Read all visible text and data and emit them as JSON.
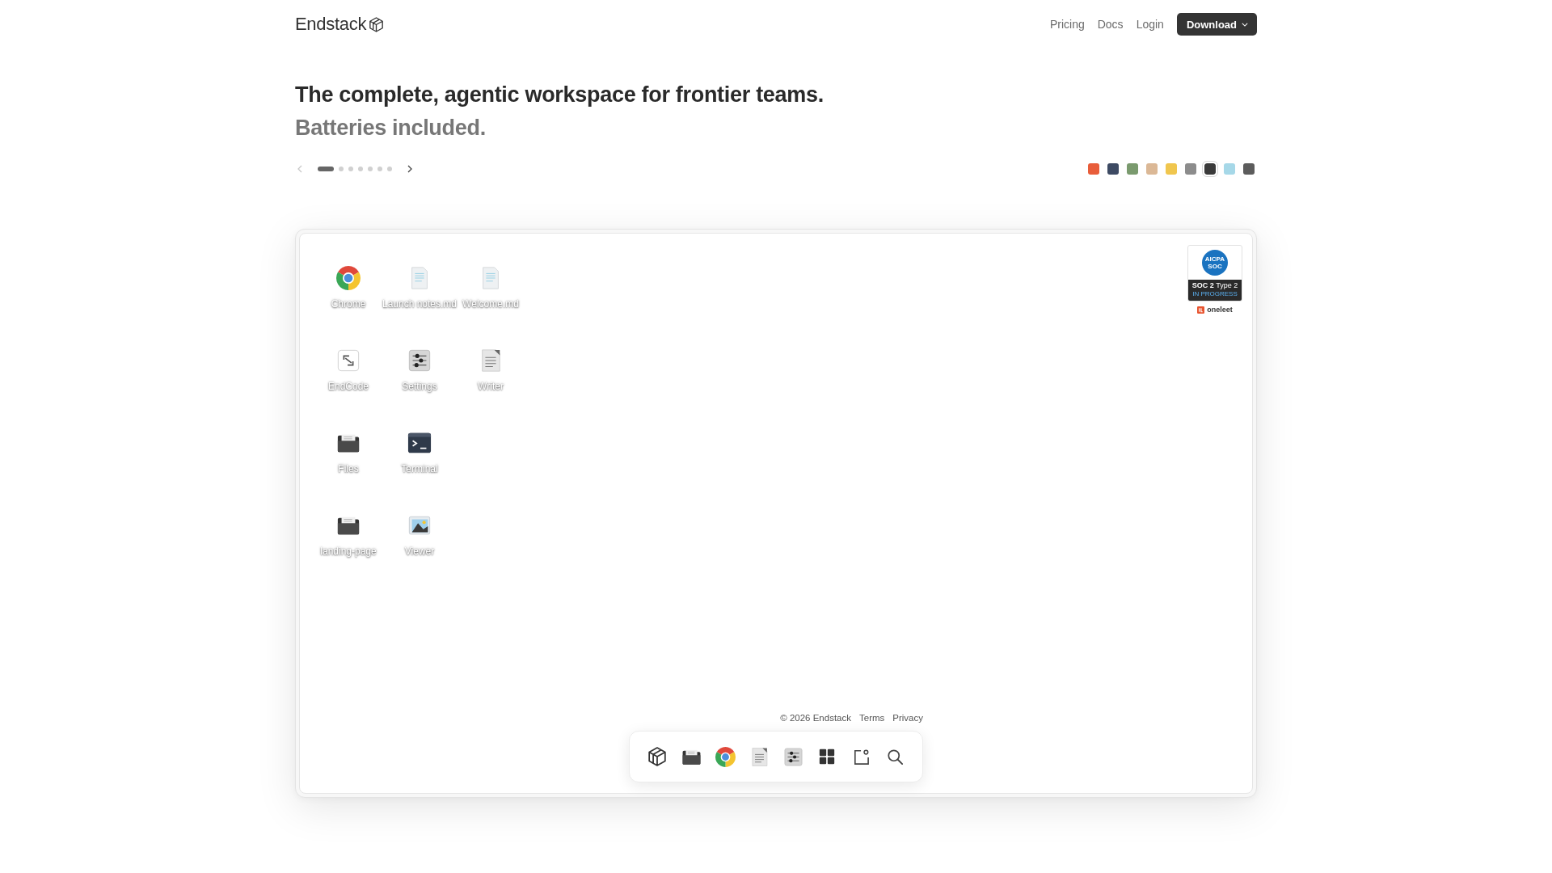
{
  "header": {
    "logo": "Endstack",
    "nav": [
      "Pricing",
      "Docs",
      "Login"
    ],
    "download_button": "Download"
  },
  "hero": {
    "title": "The complete, agentic workspace for frontier teams.",
    "subtitle": "Batteries included."
  },
  "carousel": {
    "previous": {
      "disabled": true
    },
    "next": {
      "disabled": false
    },
    "slides": [
      {
        "selected": true
      },
      {
        "selected": false
      },
      {
        "selected": false
      },
      {
        "selected": false
      },
      {
        "selected": false
      },
      {
        "selected": false
      },
      {
        "selected": false
      }
    ]
  },
  "theme_swatches": [
    {
      "color": "#e85d3a",
      "selected": false
    },
    {
      "color": "#3d4a63",
      "selected": false
    },
    {
      "color": "#7a9a6e",
      "selected": false
    },
    {
      "color": "#dbb896",
      "selected": false
    },
    {
      "color": "#f0c64e",
      "selected": false
    },
    {
      "color": "#8c8c8c",
      "selected": false
    },
    {
      "color": "#3a3a3a",
      "selected": true
    },
    {
      "color": "#a6d8e8",
      "selected": false
    },
    {
      "color": "#5c5c5c",
      "selected": false
    }
  ],
  "desktop": {
    "icons": [
      {
        "label": "Chrome",
        "kind": "browser"
      },
      {
        "label": "EndCode",
        "kind": "code"
      },
      {
        "label": "Files",
        "kind": "folder"
      },
      {
        "label": "landing-page",
        "kind": "folder"
      },
      {
        "label": "Launch notes.md",
        "kind": "markdown"
      },
      {
        "label": "Settings",
        "kind": "settings"
      },
      {
        "label": "Terminal",
        "kind": "terminal"
      },
      {
        "label": "Viewer",
        "kind": "viewer"
      },
      {
        "label": "Welcome.md",
        "kind": "markdown"
      },
      {
        "label": "Writer",
        "kind": "writer"
      }
    ],
    "badge": {
      "seal": "AICPA SOC",
      "title": "**SOC 2** Type 2",
      "status": "IN PROGRESS",
      "vendor": "oneleet"
    },
    "footer": {
      "copyright": "© 2026 Endstack",
      "links": [
        "Terms",
        "Privacy"
      ]
    },
    "dock": [
      {
        "kind": "logo"
      },
      {
        "kind": "folder"
      },
      {
        "kind": "browser"
      },
      {
        "kind": "writer"
      },
      {
        "kind": "settings"
      },
      {
        "kind": "apps"
      },
      {
        "kind": "window"
      },
      {
        "kind": "search"
      }
    ]
  }
}
